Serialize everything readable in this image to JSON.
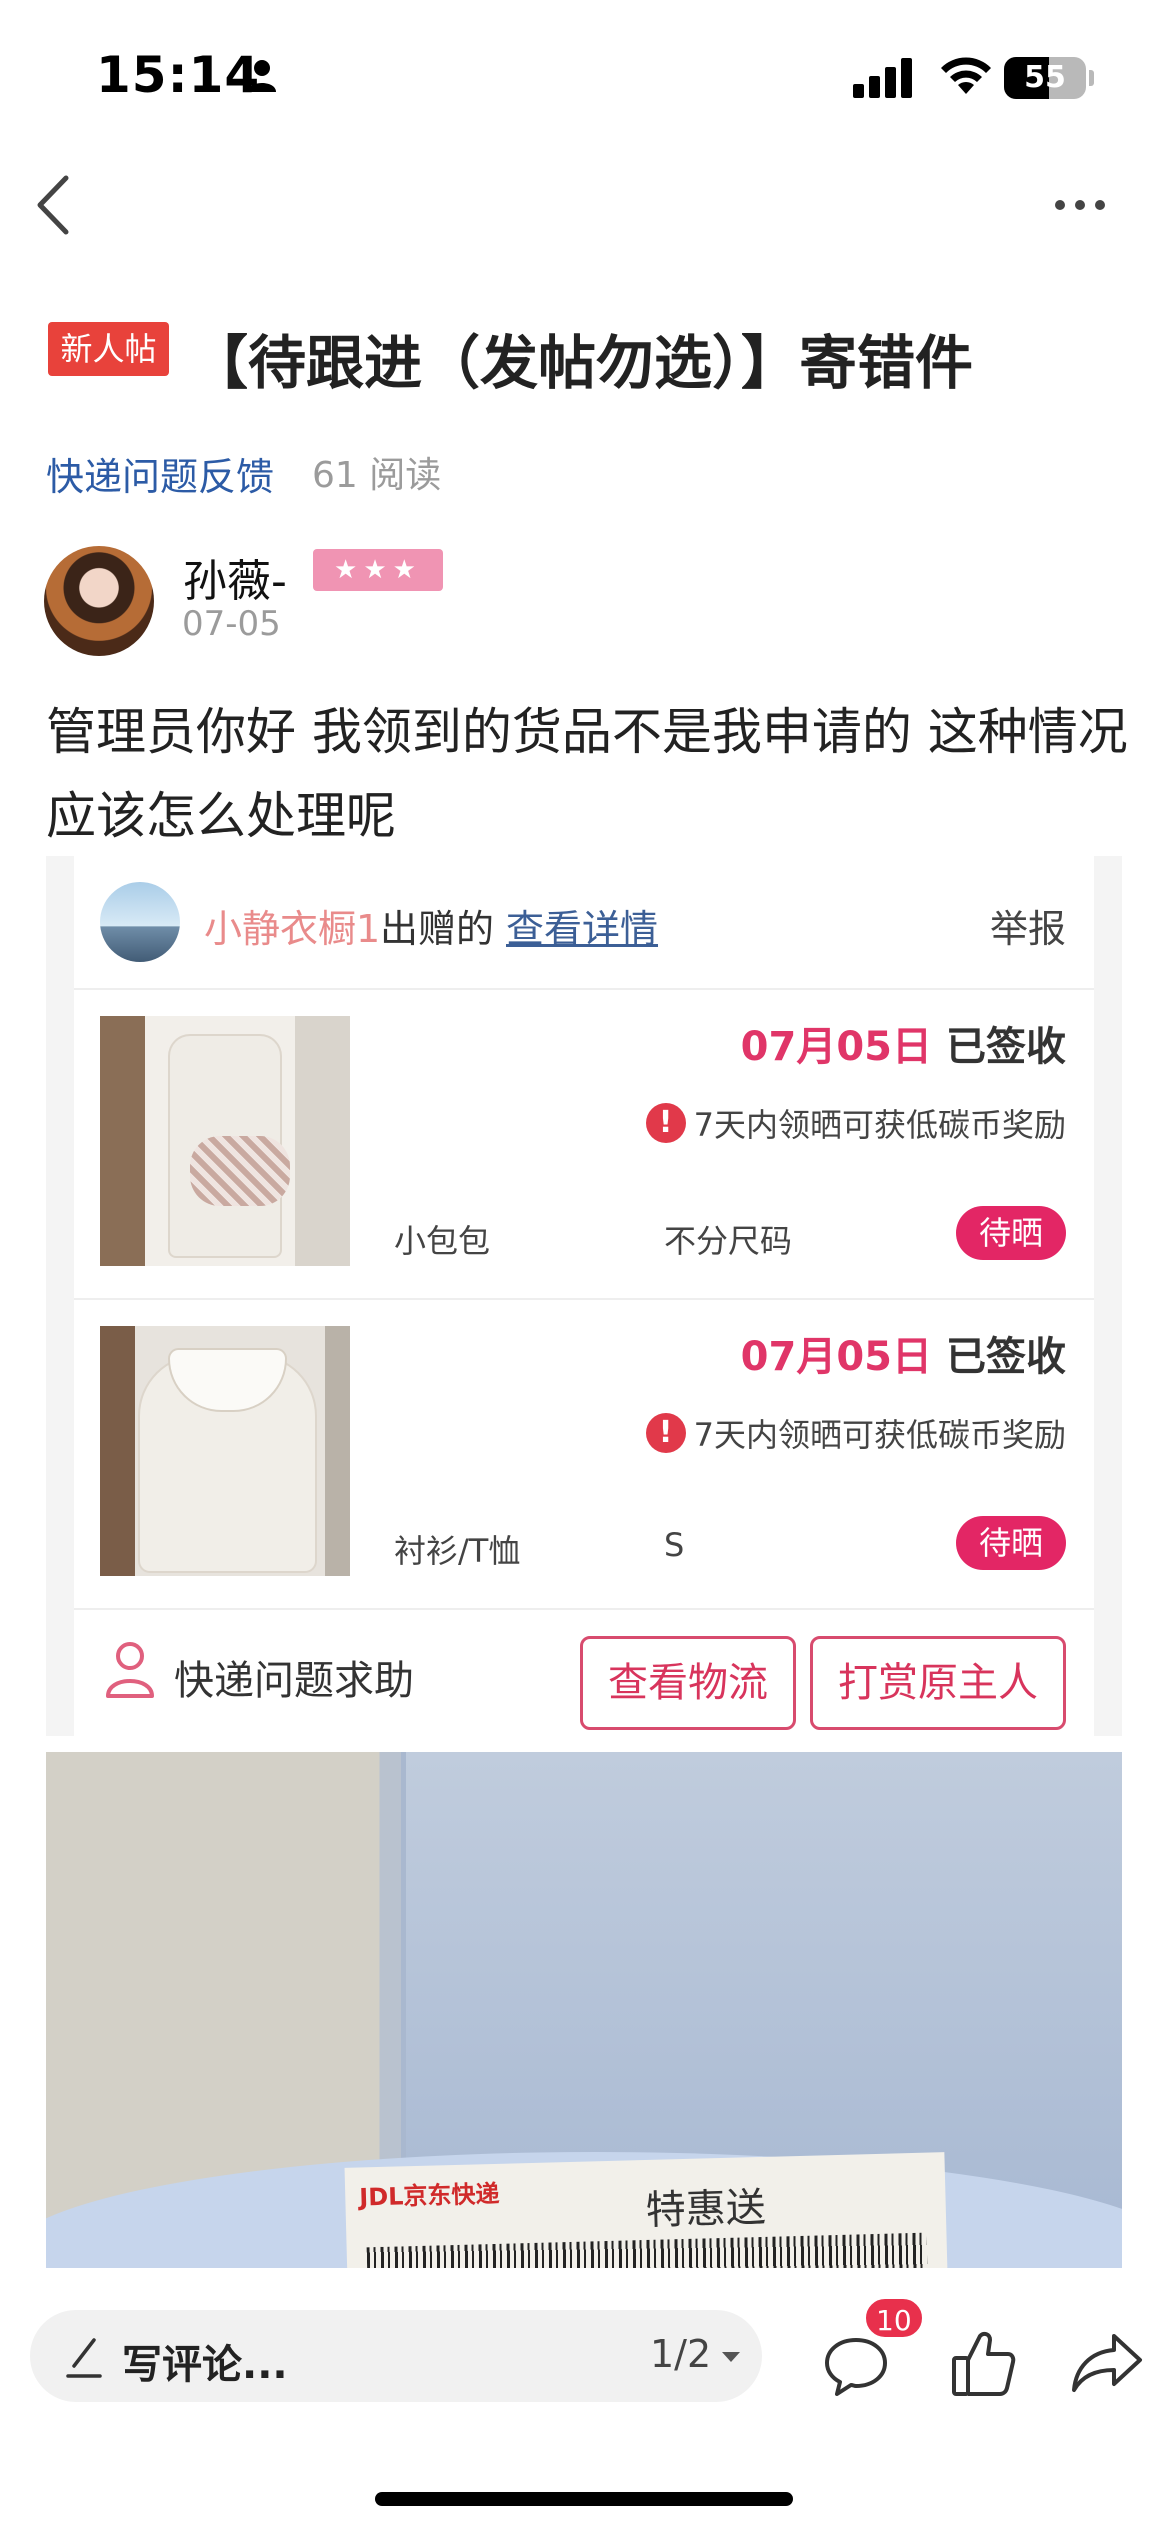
{
  "status_bar": {
    "time": "15:14",
    "battery": "55",
    "battery_level": 0.55
  },
  "nav": {
    "back_icon": "chevron-left-icon",
    "more_icon": "more-horizontal-icon"
  },
  "post": {
    "badge": "新人帖",
    "title": "【待跟进（发帖勿选）】寄错件",
    "category": "快递问题反馈",
    "read_count": "61 阅读",
    "author": {
      "name": "孙薇-",
      "stars": "★★★",
      "date": "07-05"
    },
    "body": "管理员你好   我领到的货品不是我申请的  这种情况应该怎么处理呢"
  },
  "gift_card": {
    "donor_name": "小静衣橱1",
    "donor_verb": "出赠的",
    "detail_link": "查看详情",
    "report": "举报",
    "items": [
      {
        "date": "07月05日",
        "status": "已签收",
        "notice": "7天内领晒可获低碳币奖励",
        "name": "小包包",
        "size": "不分尺码",
        "tag": "待晒"
      },
      {
        "date": "07月05日",
        "status": "已签收",
        "notice": "7天内领晒可获低碳币奖励",
        "name": "衬衫/T恤",
        "size": "S",
        "tag": "待晒"
      }
    ],
    "footer": {
      "help_label": "快递问题求助",
      "logistics_button": "查看物流",
      "reward_button": "打赏原主人"
    }
  },
  "photo": {
    "label_brand": "JDL京东快递",
    "label_text": "特惠送"
  },
  "bottom_bar": {
    "comment_placeholder": "写评论...",
    "page_indicator": "1/2",
    "comment_count": "10"
  },
  "colors": {
    "accent_red": "#e32665",
    "badge_red": "#e8423b",
    "link_blue": "#2c5ba6"
  }
}
